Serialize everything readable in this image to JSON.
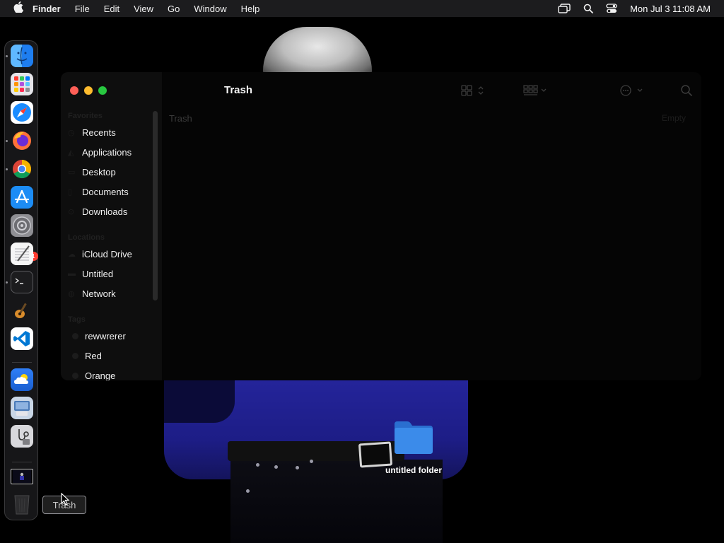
{
  "menubar": {
    "apple_icon": "apple-logo-icon",
    "app_name": "Finder",
    "menus": [
      "File",
      "Edit",
      "View",
      "Go",
      "Window",
      "Help"
    ],
    "status_icons": [
      "screen-mirroring-icon",
      "spotlight-search-icon",
      "control-center-icon"
    ],
    "clock": "Mon Jul 3  11:08 AM"
  },
  "dock": {
    "apps": [
      {
        "name": "Finder",
        "icon": "finder-icon"
      },
      {
        "name": "Launchpad",
        "icon": "launchpad-icon"
      },
      {
        "name": "Safari",
        "icon": "safari-icon"
      },
      {
        "name": "Firefox",
        "icon": "firefox-icon"
      },
      {
        "name": "Chrome",
        "icon": "chrome-icon"
      },
      {
        "name": "App Store",
        "icon": "app-store-icon"
      },
      {
        "name": "System Settings",
        "icon": "system-settings-icon",
        "badge": "1"
      },
      {
        "name": "TextEdit",
        "icon": "textedit-icon"
      },
      {
        "name": "Terminal",
        "icon": "terminal-icon"
      },
      {
        "name": "GarageBand",
        "icon": "garageband-icon"
      },
      {
        "name": "Visual Studio Code",
        "icon": "vscode-icon"
      },
      {
        "name": "Weather",
        "icon": "weather-icon"
      },
      {
        "name": "Preview",
        "icon": "preview-icon"
      },
      {
        "name": "System Information",
        "icon": "system-information-icon"
      },
      {
        "name": "Desktop Thumbnail",
        "icon": "minimized-window-icon"
      },
      {
        "name": "Trash",
        "icon": "trash-icon"
      }
    ],
    "tooltip": "Trash"
  },
  "finder": {
    "title": "Trash",
    "path_label": "Trash",
    "empty_button": "Empty",
    "toolbar_icons": [
      "icon-view-icon",
      "group-by-icon",
      "action-menu-icon",
      "search-icon"
    ],
    "sections": [
      {
        "heading": "Favorites",
        "items": [
          "Recents",
          "Applications",
          "Desktop",
          "Documents",
          "Downloads"
        ]
      },
      {
        "heading": "Locations",
        "items": [
          "iCloud Drive",
          "Untitled",
          "Network"
        ]
      },
      {
        "heading": "Tags",
        "items": [
          "rewwrerer",
          "Red",
          "Orange"
        ]
      }
    ],
    "tag_colors": {
      "rewwrerer": "#1c1c1c",
      "Red": "#1c1c1c",
      "Orange": "#1c1c1c"
    }
  },
  "desktop": {
    "folder_name": "untitled folder",
    "folder_color": "#3b8bea"
  },
  "colors": {
    "close": "#ff5f57",
    "minimize": "#febc2e",
    "zoom": "#28c840"
  }
}
